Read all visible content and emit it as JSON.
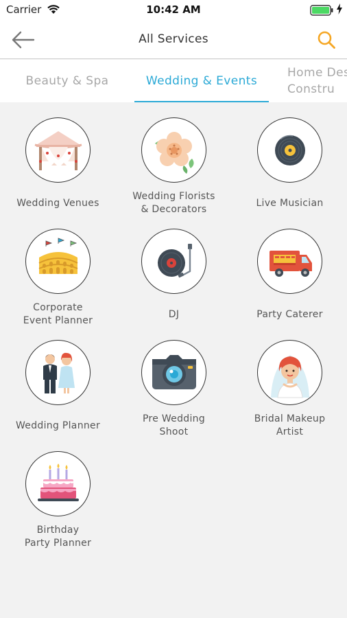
{
  "status_bar": {
    "carrier": "Carrier",
    "time": "10:42 AM"
  },
  "nav": {
    "title": "All Services",
    "back_icon": "back-arrow-icon",
    "search_icon": "search-icon",
    "accent_color": "#f5a623"
  },
  "tabs": [
    {
      "label": "Beauty & Spa",
      "active": false
    },
    {
      "label": "Wedding & Events",
      "active": true
    },
    {
      "label": "Home Des\nConstru",
      "active": false
    }
  ],
  "active_tab_color": "#2aa9d6",
  "services": [
    {
      "label": "Wedding Venues",
      "icon": "tent-icon"
    },
    {
      "label": "Wedding Florists\n& Decorators",
      "icon": "flower-icon"
    },
    {
      "label": "Live Musician",
      "icon": "vinyl-record-icon"
    },
    {
      "label": "Corporate\nEvent Planner",
      "icon": "colosseum-icon"
    },
    {
      "label": "DJ",
      "icon": "turntable-icon"
    },
    {
      "label": "Party Caterer",
      "icon": "food-truck-icon"
    },
    {
      "label": "Wedding Planner",
      "icon": "couple-icon"
    },
    {
      "label": "Pre Wedding\nShoot",
      "icon": "camera-icon"
    },
    {
      "label": "Bridal Makeup\nArtist",
      "icon": "bride-icon"
    },
    {
      "label": "Birthday\nParty Planner",
      "icon": "birthday-cake-icon"
    }
  ]
}
